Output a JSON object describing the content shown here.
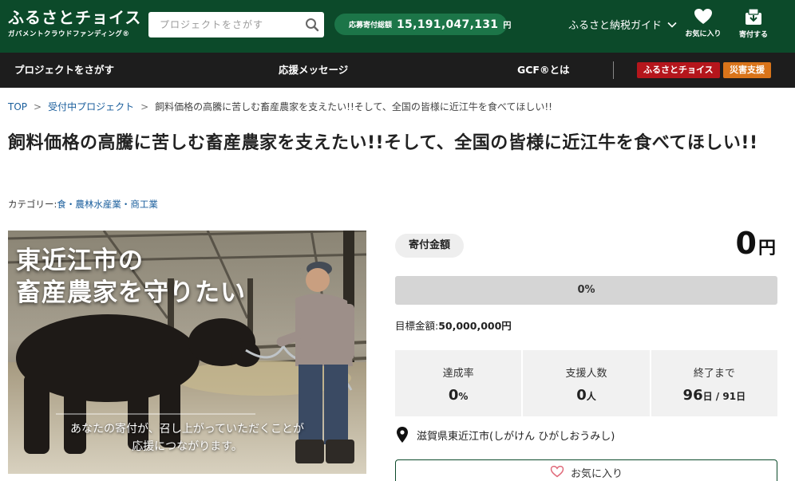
{
  "header": {
    "logo_main": "ふるさとチョイス",
    "logo_sub": "ガバメントクラウドファンディング®",
    "search_placeholder": "プロジェクトをさがす",
    "donation_label": "応募寄付総額",
    "donation_amount": "15,191,047,131",
    "donation_unit": "円",
    "guide_label": "ふるさと納税ガイド",
    "favorites_label": "お気に入り",
    "donated_label": "寄付する"
  },
  "nav": {
    "find_projects": "プロジェクトをさがす",
    "messages": "応援メッセージ",
    "about_gcf": "GCF®とは",
    "furusato_choice": "ふるさとチョイス",
    "disaster_support": "災害支援"
  },
  "breadcrumb": {
    "top": "TOP",
    "accepting": "受付中プロジェクト",
    "current": "飼料価格の高騰に苦しむ畜産農家を支えたい!!そして、全国の皆様に近江牛を食べてほしい!!",
    "separator": ">"
  },
  "project": {
    "title": "飼料価格の高騰に苦しむ畜産農家を支えたい!!そして、全国の皆様に近江牛を食べてほしい!!",
    "category_prefix": "カテゴリー:",
    "category": "食・農林水産業・商工業",
    "hero_headline_1": "東近江市の",
    "hero_headline_2": "畜産農家を守りたい",
    "hero_caption_1": "あなたの寄付が、召し上がっていただくことが",
    "hero_caption_2": "応援につながります。"
  },
  "funding": {
    "amount_label": "寄付金額",
    "amount_value": "0",
    "amount_unit": "円",
    "progress_fraction": 0,
    "progress_text": "0%",
    "goal_label": "目標金額:",
    "goal_value": "50,000,000円",
    "stats": [
      {
        "label": "達成率",
        "value": "0",
        "unit": "%",
        "extra": ""
      },
      {
        "label": "支援人数",
        "value": "0",
        "unit": "人",
        "extra": ""
      },
      {
        "label": "終了まで",
        "value": "96",
        "unit": "日",
        "extra": " / 91日"
      }
    ],
    "location": "滋賀県東近江市(しがけん ひがしおうみし)",
    "favorite_button": "お気に入り"
  },
  "colors": {
    "header_green": "#0c4a2a",
    "pill_green": "#1c7548",
    "nav_dark": "#1d1d1d",
    "badge_red": "#b5161c",
    "badge_orange": "#d9741a",
    "link_blue": "#1a5e9c",
    "heart_pink": "#e06a7a"
  },
  "icons": {
    "search": "search-icon",
    "heart": "heart-icon",
    "donate": "donate-box-icon",
    "chevron": "chevron-down-icon",
    "location": "map-pin-icon"
  }
}
